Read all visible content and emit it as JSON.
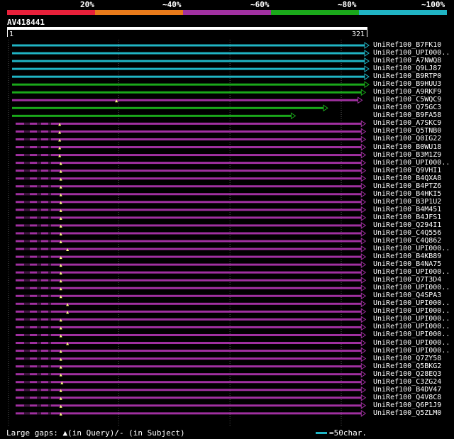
{
  "scale": {
    "labels": [
      "20%",
      "~40%",
      "~60%",
      "~80%",
      "~100%"
    ],
    "colors": [
      "#e8203a",
      "#e87a1a",
      "#a030a0",
      "#1aa81a",
      "#20b4c4"
    ]
  },
  "query": {
    "name": "AV418441",
    "start": "1",
    "end": "321",
    "length": 321
  },
  "hits": [
    {
      "label": "UniRef100_B7FK10",
      "color": "#20b4c4",
      "end": 321,
      "mark": null
    },
    {
      "label": "UniRef100_UPI000..",
      "color": "#20b4c4",
      "end": 321,
      "mark": null
    },
    {
      "label": "UniRef100_A7NWQ8",
      "color": "#20b4c4",
      "end": 321,
      "mark": null
    },
    {
      "label": "UniRef100_Q9LJ87",
      "color": "#20b4c4",
      "end": 321,
      "mark": null
    },
    {
      "label": "UniRef100_B9RTP0",
      "color": "#20b4c4",
      "end": 321,
      "mark": null
    },
    {
      "label": "UniRef100_B9HUU3",
      "color": "#1aa81a",
      "end": 321,
      "mark": null
    },
    {
      "label": "UniRef100_A9RKF9",
      "color": "#1aa81a",
      "end": 318,
      "mark": null
    },
    {
      "label": "UniRef100_C5WQC9",
      "color": "#a030a0",
      "end": 315,
      "mark": 98
    },
    {
      "label": "UniRef100_Q75GC3",
      "color": "#1aa81a",
      "end": 284,
      "mark": null
    },
    {
      "label": "UniRef100_B9FA58",
      "color": "#1aa81a",
      "end": 255,
      "mark": null
    },
    {
      "label": "UniRef100_A7SKC9",
      "color": "#a030a0",
      "end": 318,
      "mark": 47
    },
    {
      "label": "UniRef100_Q5TNB0",
      "color": "#a030a0",
      "end": 318,
      "mark": 47
    },
    {
      "label": "UniRef100_Q0IG22",
      "color": "#a030a0",
      "end": 318,
      "mark": 47
    },
    {
      "label": "UniRef100_B0WU18",
      "color": "#a030a0",
      "end": 318,
      "mark": 47
    },
    {
      "label": "UniRef100_B3M1Z9",
      "color": "#a030a0",
      "end": 318,
      "mark": 47
    },
    {
      "label": "UniRef100_UPI000..",
      "color": "#a030a0",
      "end": 318,
      "mark": 48
    },
    {
      "label": "UniRef100_Q9VHI1",
      "color": "#a030a0",
      "end": 318,
      "mark": 48
    },
    {
      "label": "UniRef100_B4QXA8",
      "color": "#a030a0",
      "end": 318,
      "mark": 48
    },
    {
      "label": "UniRef100_B4PTZ6",
      "color": "#a030a0",
      "end": 318,
      "mark": 48
    },
    {
      "label": "UniRef100_B4HKI5",
      "color": "#a030a0",
      "end": 318,
      "mark": 48
    },
    {
      "label": "UniRef100_B3P1U2",
      "color": "#a030a0",
      "end": 318,
      "mark": 48
    },
    {
      "label": "UniRef100_B4M451",
      "color": "#a030a0",
      "end": 318,
      "mark": 48
    },
    {
      "label": "UniRef100_B4JFS1",
      "color": "#a030a0",
      "end": 318,
      "mark": 48
    },
    {
      "label": "UniRef100_Q294I1",
      "color": "#a030a0",
      "end": 318,
      "mark": 48
    },
    {
      "label": "UniRef100_C4Q556",
      "color": "#a030a0",
      "end": 318,
      "mark": 48
    },
    {
      "label": "UniRef100_C4Q862",
      "color": "#a030a0",
      "end": 318,
      "mark": 48
    },
    {
      "label": "UniRef100_UPI000..",
      "color": "#a030a0",
      "end": 318,
      "mark": 54
    },
    {
      "label": "UniRef100_B4KB89",
      "color": "#a030a0",
      "end": 318,
      "mark": 48
    },
    {
      "label": "UniRef100_B4NA75",
      "color": "#a030a0",
      "end": 318,
      "mark": 48
    },
    {
      "label": "UniRef100_UPI000..",
      "color": "#a030a0",
      "end": 318,
      "mark": 48
    },
    {
      "label": "UniRef100_Q7T3D4",
      "color": "#a030a0",
      "end": 318,
      "mark": 48
    },
    {
      "label": "UniRef100_UPI000..",
      "color": "#a030a0",
      "end": 318,
      "mark": 48
    },
    {
      "label": "UniRef100_Q4SPA3",
      "color": "#a030a0",
      "end": 318,
      "mark": 48
    },
    {
      "label": "UniRef100_UPI000..",
      "color": "#a030a0",
      "end": 318,
      "mark": 54
    },
    {
      "label": "UniRef100_UPI000..",
      "color": "#a030a0",
      "end": 318,
      "mark": 54
    },
    {
      "label": "UniRef100_UPI000..",
      "color": "#a030a0",
      "end": 318,
      "mark": 48
    },
    {
      "label": "UniRef100_UPI000..",
      "color": "#a030a0",
      "end": 318,
      "mark": 48
    },
    {
      "label": "UniRef100_UPI000..",
      "color": "#a030a0",
      "end": 318,
      "mark": 48
    },
    {
      "label": "UniRef100_UPI000..",
      "color": "#a030a0",
      "end": 318,
      "mark": 54
    },
    {
      "label": "UniRef100_UPI000..",
      "color": "#a030a0",
      "end": 318,
      "mark": 48
    },
    {
      "label": "UniRef100_Q7ZY58",
      "color": "#a030a0",
      "end": 318,
      "mark": 48
    },
    {
      "label": "UniRef100_Q5BKG2",
      "color": "#a030a0",
      "end": 318,
      "mark": 48
    },
    {
      "label": "UniRef100_Q28EQ3",
      "color": "#a030a0",
      "end": 318,
      "mark": 48
    },
    {
      "label": "UniRef100_C3ZG24",
      "color": "#a030a0",
      "end": 318,
      "mark": 49
    },
    {
      "label": "UniRef100_B4DV47",
      "color": "#a030a0",
      "end": 318,
      "mark": 48
    },
    {
      "label": "UniRef100_Q4V8C8",
      "color": "#a030a0",
      "end": 318,
      "mark": 48
    },
    {
      "label": "UniRef100_Q6P1J9",
      "color": "#a030a0",
      "end": 318,
      "mark": 48
    },
    {
      "label": "UniRef100_Q5ZLM0",
      "color": "#a030a0",
      "end": 318,
      "mark": 48
    }
  ],
  "footer": {
    "gaps_text": "Large gaps: ▲(in Query)/- (in Subject)",
    "legend_color": "#20b4c4",
    "legend_text": "=50char."
  }
}
